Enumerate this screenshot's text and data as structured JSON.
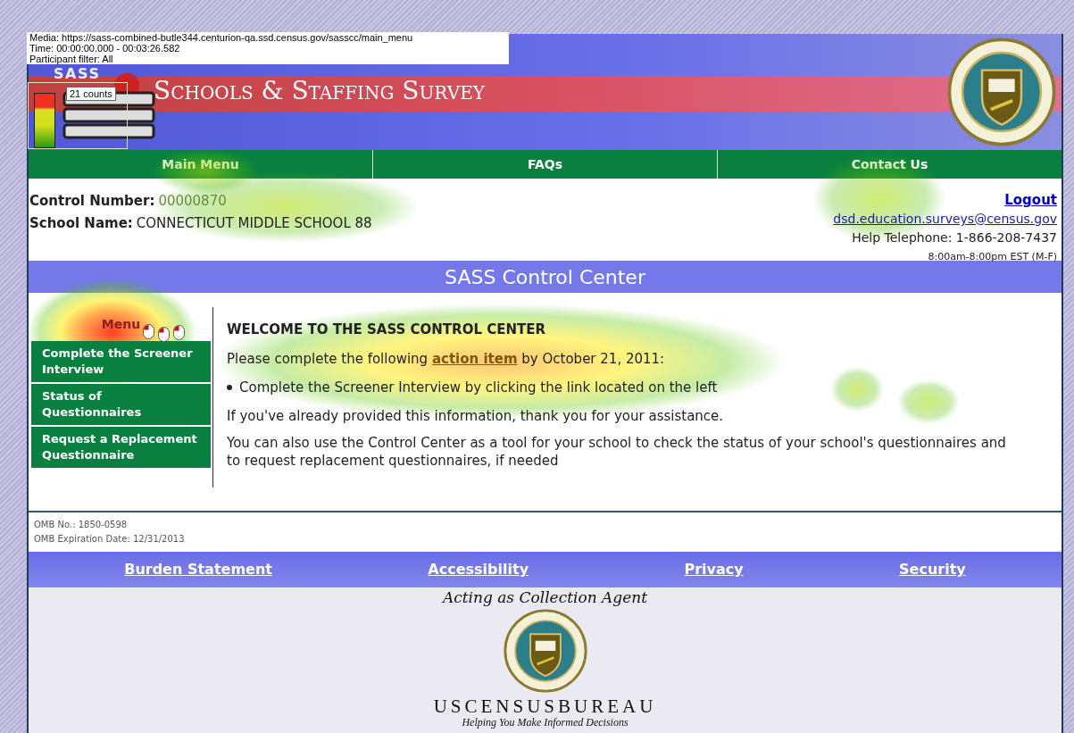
{
  "overlay_info": {
    "lines": [
      "Media: https://sass-combined-butle344.centurion-qa.ssd.census.gov/sasscc/main_menu",
      "Time: 00:00:00.000 - 00:03:26.582",
      "Participant filter: All"
    ]
  },
  "legend": {
    "label": "21 counts"
  },
  "header": {
    "logo_text": "SASS",
    "title": "Schools & Staffing Survey"
  },
  "nav": [
    {
      "label": "Main Menu"
    },
    {
      "label": "FAQs"
    },
    {
      "label": "Contact Us"
    }
  ],
  "school_info": {
    "control_number_label": "Control Number:",
    "control_number": "00000870",
    "school_name_label": "School Name:",
    "school_name": "CONNECTICUT MIDDLE SCHOOL 88"
  },
  "contact": {
    "logout": "Logout",
    "email": "dsd.education.surveys@census.gov",
    "phone": "Help Telephone: 1-866-208-7437",
    "hours": "8:00am-8:00pm EST (M-F)"
  },
  "page_title": "SASS Control Center",
  "side_menu": {
    "title": "Menu",
    "items": [
      {
        "label": "Complete the Screener Interview"
      },
      {
        "label": "Status of Questionnaires"
      },
      {
        "label": "Request a Replacement Questionnaire"
      }
    ]
  },
  "welcome": {
    "heading": "WELCOME TO THE SASS CONTROL CENTER",
    "intro_before": "Please complete the following",
    "intro_link": "action item",
    "intro_after": "by October 21, 2011:",
    "bullets": [
      "Complete the Screener Interview by clicking the link located on the left"
    ],
    "paragraphs": [
      "If you've already provided this information, thank you for your assistance.",
      "You can also use the Control Center as a tool for your school to check the status of your school's questionnaires and to request replacement questionnaires, if needed"
    ]
  },
  "omb": [
    "OMB No.: 1850-0598",
    "OMB Expiration Date: 12/31/2013"
  ],
  "footer_links": [
    "Burden Statement",
    "Accessibility",
    "Privacy",
    "Security"
  ],
  "agent": {
    "caption": "Acting as Collection Agent",
    "bureau": "USCENSUSBUREAU",
    "tagline": "Helping You Make Informed Decisions"
  }
}
